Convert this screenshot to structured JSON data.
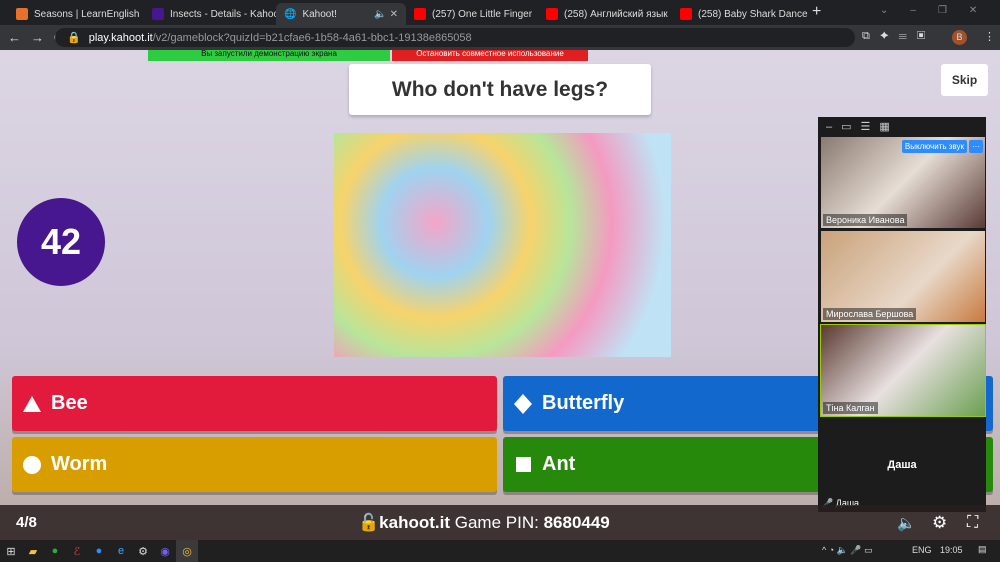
{
  "browser": {
    "tabs": [
      {
        "title": "Seasons | LearnEnglish",
        "icon": "learnenglish-icon",
        "color": "#e8702a"
      },
      {
        "title": "Insects - Details - Kahoot",
        "icon": "kahoot-icon",
        "color": "#46178f"
      },
      {
        "title": "Kahoot!",
        "icon": "globe-icon",
        "color": "#bbbbbb",
        "audio": true
      },
      {
        "title": "(257) One Little Finger",
        "icon": "youtube-icon",
        "color": "#ff0000"
      },
      {
        "title": "(258) Английский язык",
        "icon": "youtube-icon",
        "color": "#ff0000"
      },
      {
        "title": "(258) Baby Shark Dance",
        "icon": "youtube-icon",
        "color": "#ff0000"
      }
    ],
    "url_host": "play.kahoot.it",
    "url_path": "/v2/gameblock?quizId=b21cfae6-1b58-4a61-bbc1-19138e865058",
    "profile": "B"
  },
  "share": {
    "started": "Вы запустили демонстрацию экрана",
    "stop": "Остановить совместное использование"
  },
  "game": {
    "question": "Who don't have legs?",
    "skip": "Skip",
    "timer": "42",
    "answers": [
      {
        "label": "Bee",
        "shape": "triangle",
        "color": "#e21b3c"
      },
      {
        "label": "Butterfly",
        "shape": "diamond",
        "color": "#1368ce"
      },
      {
        "label": "Worm",
        "shape": "circle",
        "color": "#d89e00"
      },
      {
        "label": "Ant",
        "shape": "square",
        "color": "#26890c"
      }
    ],
    "progress": "4/8",
    "site": "kahoot.it",
    "pin_label": "Game PIN:",
    "pin": "8680449"
  },
  "zoom": {
    "mute_button": "Выключить звук",
    "more": "···",
    "participants": [
      "Вероника Иванова",
      "Мирослава Бершова",
      "Тіна Калган"
    ],
    "self_name": "Даша",
    "self_label": "Даша"
  },
  "taskbar": {
    "lang": "ENG",
    "time": "19:05"
  }
}
